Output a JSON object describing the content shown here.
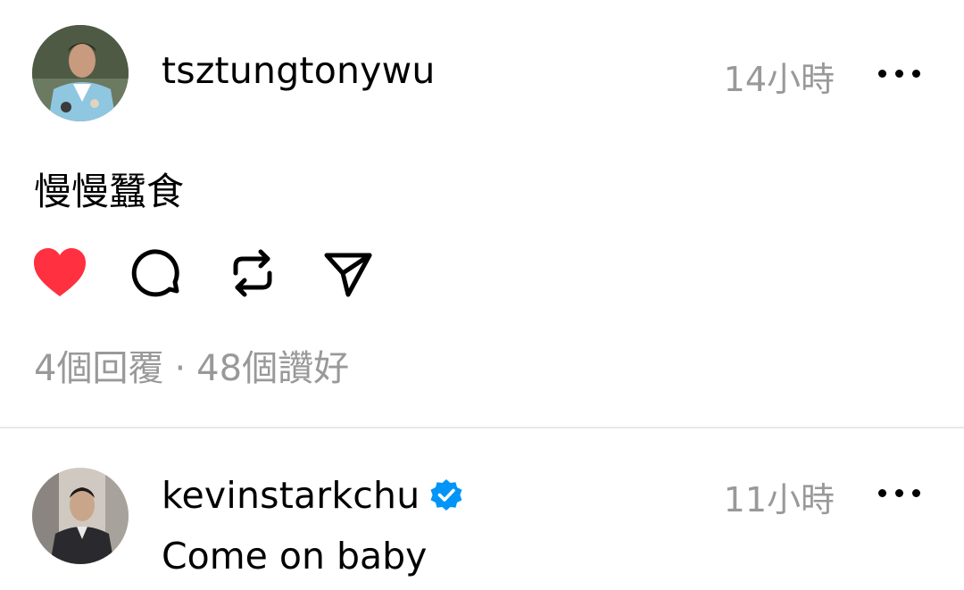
{
  "posts": [
    {
      "username": "tsztungtonywu",
      "timestamp": "14小時",
      "text": "慢慢蠶食",
      "liked": true,
      "like_color": "#ff3040",
      "stats": {
        "replies": "4個回覆",
        "separator": "·",
        "likes": "48個讚好"
      }
    },
    {
      "username": "kevinstarkchu",
      "verified": true,
      "verified_color": "#0095f6",
      "timestamp": "11小時",
      "text": "Come on baby"
    }
  ],
  "icons": {
    "like": "heart-icon",
    "comment": "comment-icon",
    "repost": "repost-icon",
    "share": "send-icon",
    "more": "more-options-icon",
    "verified": "verified-badge-icon"
  },
  "colors": {
    "text": "#000000",
    "secondary_text": "#999999",
    "divider": "#e8e8e8"
  }
}
